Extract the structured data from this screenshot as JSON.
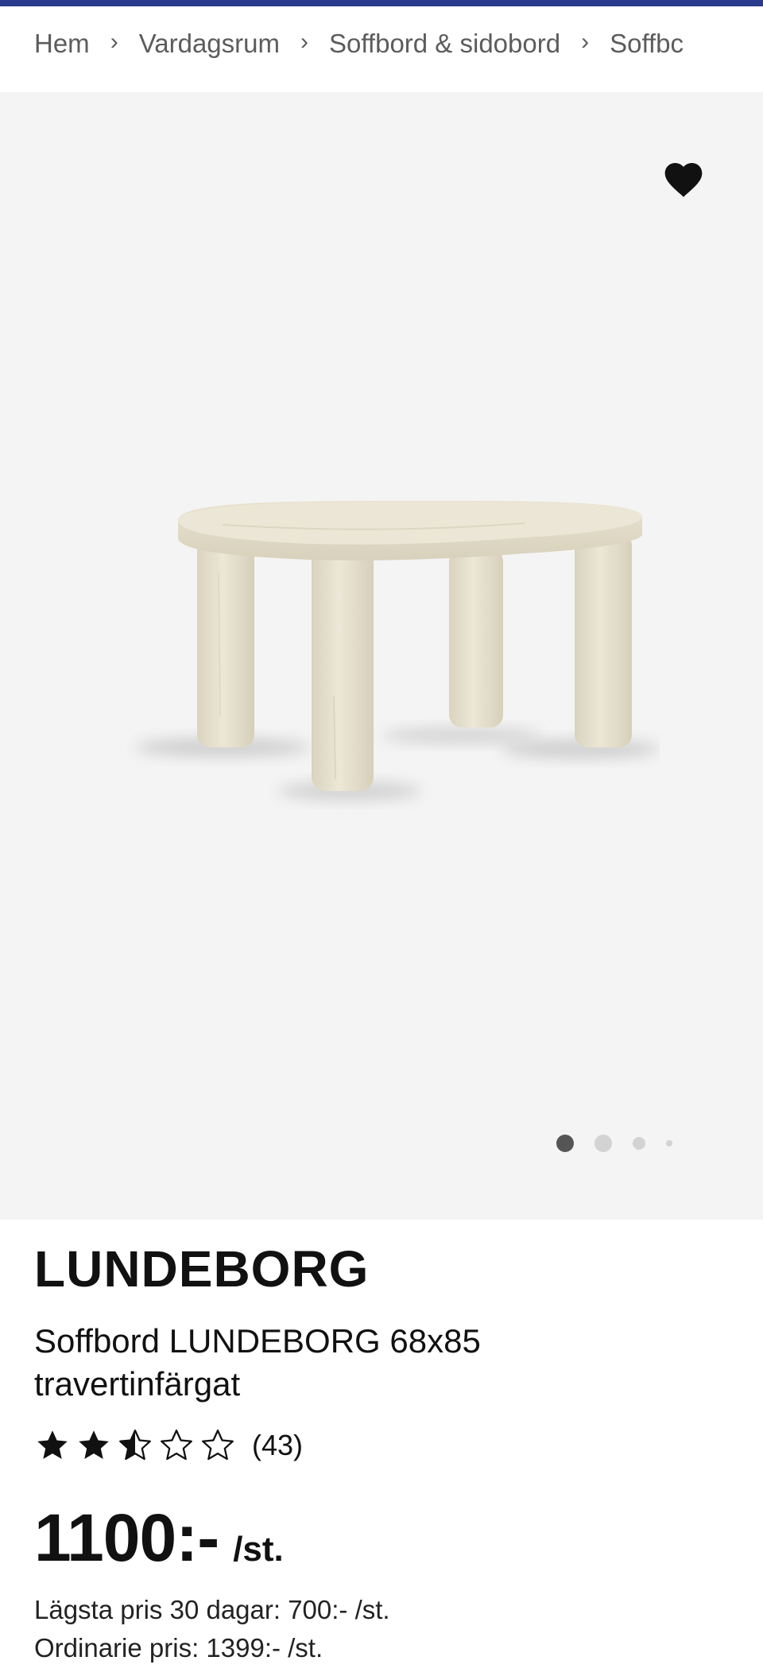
{
  "breadcrumb": {
    "items": [
      "Hem",
      "Vardagsrum",
      "Soffbord & sidobord",
      "Soffbc"
    ],
    "separator": "›"
  },
  "gallery": {
    "favorite_icon": "heart-icon",
    "image": "travertine oval coffee table",
    "dots_total": 4,
    "active_dot": 0
  },
  "product": {
    "brand": "LUNDEBORG",
    "name": "Soffbord LUNDEBORG 68x85 travertinfärgat",
    "rating": 2.5,
    "review_count": "(43)",
    "price": "1100:-",
    "price_unit": "/st.",
    "lowest_price": "Lägsta pris 30 dagar: 700:- /st.",
    "regular_price": "Ordinarie pris: 1399:- /st."
  },
  "colors": {
    "top_bar": "#2a3a8c",
    "gallery_bg": "#f4f4f4",
    "travertine": "#e7e1cf"
  }
}
